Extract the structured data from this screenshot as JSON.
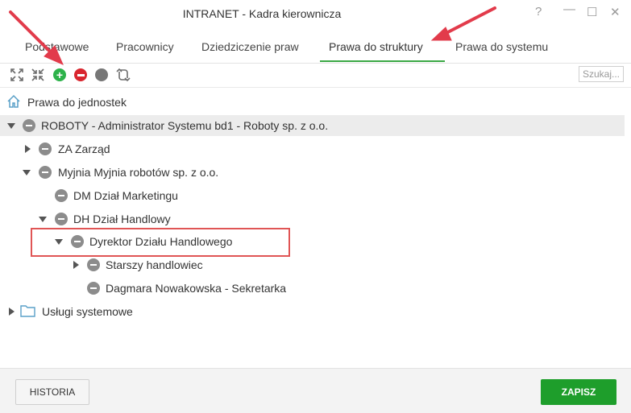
{
  "window": {
    "title": "INTRANET - Kadra kierownicza",
    "help": "?",
    "minimize": "—",
    "maximize": "☐",
    "close": "✕"
  },
  "tabs": [
    {
      "label": "Podstawowe",
      "active": false
    },
    {
      "label": "Pracownicy",
      "active": false
    },
    {
      "label": "Dziedziczenie praw",
      "active": false
    },
    {
      "label": "Prawa do struktury",
      "active": true
    },
    {
      "label": "Prawa do systemu",
      "active": false
    }
  ],
  "toolbar": {
    "icons": [
      "expand-all-icon",
      "collapse-all-icon",
      "add-icon",
      "remove-icon",
      "neutral-icon",
      "refresh-icon"
    ],
    "search_placeholder": "Szukaj..."
  },
  "tree": {
    "root_label": "Prawa do jednostek",
    "nodes": [
      {
        "label": "ROBOTY - Administrator Systemu bd1 - Roboty sp. z o.o.",
        "level": 0,
        "expanded": true,
        "selected": true
      },
      {
        "label": "ZA Zarząd",
        "level": 1,
        "expanded": false
      },
      {
        "label": "Myjnia Myjnia robotów sp. z o.o.",
        "level": 1,
        "expanded": true
      },
      {
        "label": "DM Dział Marketingu",
        "level": 2,
        "leaf": true
      },
      {
        "label": "DH Dział Handlowy",
        "level": 2,
        "expanded": true
      },
      {
        "label": "Dyrektor Działu Handlowego",
        "level": 3,
        "expanded": true,
        "highlighted": true
      },
      {
        "label": "Starszy handlowiec",
        "level": 4,
        "expanded": false
      },
      {
        "label": "Dagmara Nowakowska - Sekretarka",
        "level": 4,
        "leaf": true
      }
    ],
    "folder_label": "Usługi systemowe"
  },
  "footer": {
    "history_label": "HISTORIA",
    "save_label": "ZAPISZ"
  },
  "colors": {
    "accent_green": "#1e9e2b",
    "tab_underline": "#3aa845",
    "annotation_red": "#e05555",
    "add_green": "#2db24a",
    "remove_red": "#d9262f"
  }
}
